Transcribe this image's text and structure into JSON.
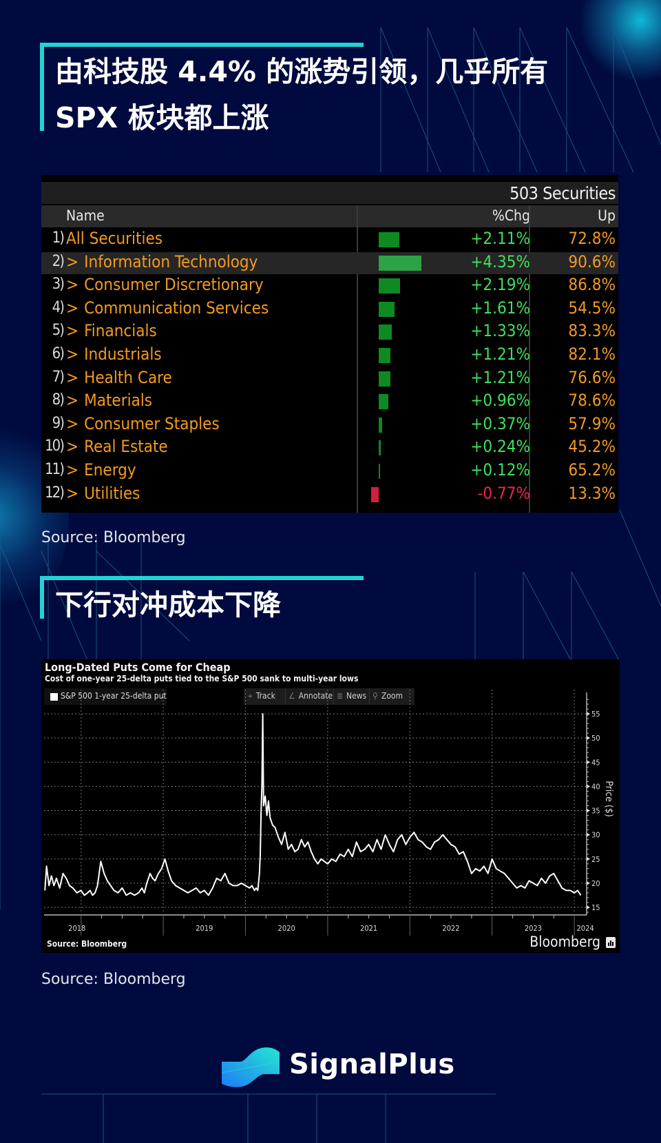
{
  "section1": {
    "heading_line1": "由科技股 4.4% 的涨势引领，几乎所有",
    "heading_line2": "SPX 板块都上涨",
    "source": "Source: Bloomberg"
  },
  "table": {
    "securities_count": "503 Securities",
    "columns": {
      "name": "Name",
      "chg": "%Chg",
      "up": "Up"
    },
    "rows": [
      {
        "index": "1)",
        "name": "All Securities",
        "expandable": false,
        "chg": "+2.11%",
        "chg_value": 2.11,
        "up": "72.8%",
        "selected": false
      },
      {
        "index": "2)",
        "name": "Information Technology",
        "expandable": true,
        "chg": "+4.35%",
        "chg_value": 4.35,
        "up": "90.6%",
        "selected": true
      },
      {
        "index": "3)",
        "name": "Consumer Discretionary",
        "expandable": true,
        "chg": "+2.19%",
        "chg_value": 2.19,
        "up": "86.8%",
        "selected": false
      },
      {
        "index": "4)",
        "name": "Communication Services",
        "expandable": true,
        "chg": "+1.61%",
        "chg_value": 1.61,
        "up": "54.5%",
        "selected": false
      },
      {
        "index": "5)",
        "name": "Financials",
        "expandable": true,
        "chg": "+1.33%",
        "chg_value": 1.33,
        "up": "83.3%",
        "selected": false
      },
      {
        "index": "6)",
        "name": "Industrials",
        "expandable": true,
        "chg": "+1.21%",
        "chg_value": 1.21,
        "up": "82.1%",
        "selected": false
      },
      {
        "index": "7)",
        "name": "Health Care",
        "expandable": true,
        "chg": "+1.21%",
        "chg_value": 1.21,
        "up": "76.6%",
        "selected": false
      },
      {
        "index": "8)",
        "name": "Materials",
        "expandable": true,
        "chg": "+0.96%",
        "chg_value": 0.96,
        "up": "78.6%",
        "selected": false
      },
      {
        "index": "9)",
        "name": "Consumer Staples",
        "expandable": true,
        "chg": "+0.37%",
        "chg_value": 0.37,
        "up": "57.9%",
        "selected": false
      },
      {
        "index": "10)",
        "name": "Real Estate",
        "expandable": true,
        "chg": "+0.24%",
        "chg_value": 0.24,
        "up": "45.2%",
        "selected": false
      },
      {
        "index": "11)",
        "name": "Energy",
        "expandable": true,
        "chg": "+0.12%",
        "chg_value": 0.12,
        "up": "65.2%",
        "selected": false
      },
      {
        "index": "12)",
        "name": "Utilities",
        "expandable": true,
        "chg": "-0.77%",
        "chg_value": -0.77,
        "up": "13.3%",
        "selected": false
      }
    ],
    "chevron_glyph": ">"
  },
  "section2": {
    "heading": "下行对冲成本下降",
    "source": "Source: Bloomberg"
  },
  "chart_toolbar": {
    "track": "Track",
    "track_icon": "crosshair-icon",
    "annotate": "Annotate",
    "annotate_icon": "pencil-icon",
    "news": "News",
    "news_icon": "news-icon",
    "zoom": "Zoom",
    "zoom_icon": "magnifier-icon"
  },
  "chart_footer": {
    "source": "Source: Bloomberg",
    "brand": "Bloomberg"
  },
  "chart_data": {
    "type": "line",
    "title": "Long-Dated Puts Come for Cheap",
    "subtitle": "Cost of one-year 25-delta puts tied to the S&P 500 sank to multi-year lows",
    "legend": [
      "S&P 500 1-year 25-delta put"
    ],
    "legend_position": "top-left",
    "xlabel": "",
    "ylabel": "Price ($)",
    "ylim": [
      14,
      58
    ],
    "y_ticks": [
      15,
      20,
      25,
      30,
      35,
      40,
      45,
      50,
      55
    ],
    "x_tick_labels": [
      "2018",
      "2019",
      "2020",
      "2021",
      "2022",
      "2023",
      "2024"
    ],
    "xlim": [
      2017.55,
      2024.15
    ],
    "grid": true,
    "series": [
      {
        "name": "S&P 500 1-year 25-delta put",
        "color": "#ffffff",
        "x": [
          2017.56,
          2017.58,
          2017.61,
          2017.64,
          2017.67,
          2017.7,
          2017.74,
          2017.78,
          2017.82,
          2017.86,
          2017.9,
          2017.95,
          2018.0,
          2018.04,
          2018.08,
          2018.11,
          2018.14,
          2018.17,
          2018.2,
          2018.24,
          2018.28,
          2018.32,
          2018.36,
          2018.4,
          2018.45,
          2018.5,
          2018.55,
          2018.6,
          2018.65,
          2018.7,
          2018.74,
          2018.77,
          2018.8,
          2018.84,
          2018.87,
          2018.9,
          2018.94,
          2018.98,
          2019.02,
          2019.06,
          2019.1,
          2019.15,
          2019.2,
          2019.25,
          2019.3,
          2019.35,
          2019.4,
          2019.45,
          2019.5,
          2019.55,
          2019.6,
          2019.65,
          2019.7,
          2019.75,
          2019.8,
          2019.85,
          2019.9,
          2019.95,
          2020.0,
          2020.05,
          2020.08,
          2020.11,
          2020.13,
          2020.15,
          2020.17,
          2020.18,
          2020.19,
          2020.2,
          2020.21,
          2020.22,
          2020.24,
          2020.26,
          2020.28,
          2020.3,
          2020.33,
          2020.36,
          2020.4,
          2020.44,
          2020.48,
          2020.52,
          2020.56,
          2020.6,
          2020.64,
          2020.68,
          2020.72,
          2020.76,
          2020.8,
          2020.84,
          2020.88,
          2020.92,
          2020.96,
          2021.0,
          2021.05,
          2021.1,
          2021.15,
          2021.2,
          2021.25,
          2021.3,
          2021.35,
          2021.4,
          2021.45,
          2021.5,
          2021.55,
          2021.6,
          2021.65,
          2021.7,
          2021.75,
          2021.8,
          2021.85,
          2021.9,
          2021.95,
          2022.0,
          2022.05,
          2022.1,
          2022.15,
          2022.2,
          2022.25,
          2022.3,
          2022.35,
          2022.4,
          2022.45,
          2022.5,
          2022.55,
          2022.6,
          2022.65,
          2022.7,
          2022.75,
          2022.8,
          2022.85,
          2022.9,
          2022.95,
          2023.0,
          2023.05,
          2023.1,
          2023.15,
          2023.2,
          2023.25,
          2023.3,
          2023.35,
          2023.4,
          2023.45,
          2023.5,
          2023.55,
          2023.6,
          2023.65,
          2023.7,
          2023.75,
          2023.8,
          2023.85,
          2023.9,
          2023.95,
          2024.0,
          2024.04,
          2024.08
        ],
        "y": [
          18.5,
          23.5,
          19.5,
          21.5,
          19.5,
          21.0,
          19.0,
          22.0,
          21.0,
          19.5,
          19.0,
          18.0,
          18.5,
          17.5,
          18.0,
          18.5,
          17.5,
          18.0,
          19.5,
          24.5,
          22.0,
          20.5,
          19.5,
          18.5,
          18.0,
          19.0,
          17.5,
          18.0,
          17.5,
          18.0,
          19.0,
          18.0,
          20.0,
          22.0,
          21.0,
          20.5,
          22.0,
          23.0,
          25.0,
          22.5,
          20.5,
          19.5,
          19.0,
          18.5,
          18.0,
          18.5,
          19.0,
          18.0,
          18.5,
          17.5,
          19.0,
          21.0,
          20.5,
          22.0,
          20.0,
          19.5,
          19.5,
          20.0,
          19.5,
          19.0,
          19.5,
          18.5,
          19.0,
          18.5,
          22.0,
          26.0,
          35.0,
          40.0,
          55.0,
          36.0,
          38.0,
          34.0,
          37.0,
          33.5,
          32.0,
          31.5,
          29.5,
          28.0,
          30.5,
          27.0,
          28.0,
          26.5,
          27.0,
          29.0,
          27.5,
          28.5,
          26.5,
          25.0,
          24.0,
          25.0,
          24.5,
          24.0,
          25.0,
          24.5,
          26.0,
          25.5,
          27.0,
          25.5,
          28.5,
          26.5,
          27.0,
          28.0,
          26.5,
          29.0,
          27.0,
          30.0,
          28.0,
          26.5,
          29.0,
          30.0,
          28.0,
          29.5,
          30.5,
          29.0,
          28.5,
          27.5,
          27.0,
          28.5,
          29.0,
          30.0,
          29.0,
          28.0,
          27.5,
          26.0,
          26.5,
          24.5,
          22.0,
          23.0,
          22.5,
          23.5,
          22.0,
          25.0,
          23.0,
          22.5,
          22.0,
          21.0,
          20.0,
          19.0,
          19.5,
          19.0,
          20.5,
          20.0,
          19.5,
          21.0,
          20.0,
          21.5,
          22.0,
          20.5,
          19.0,
          18.5,
          18.5,
          18.0,
          18.5,
          17.5,
          18.0
        ]
      }
    ]
  },
  "footer": {
    "brand": "SignalPlus",
    "logo_icon": "signalplus-logo-icon"
  }
}
